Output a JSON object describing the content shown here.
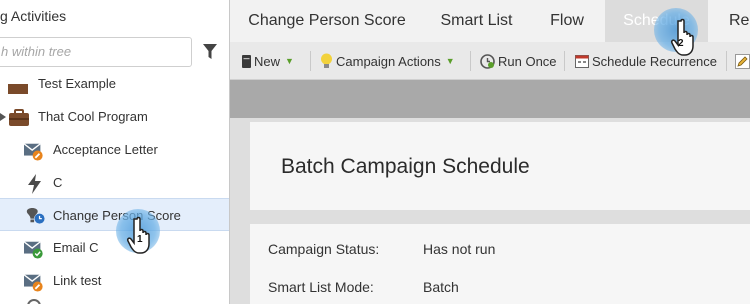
{
  "sidebar": {
    "title": "g Activities",
    "search_placeholder": "h within tree",
    "items": [
      {
        "label": "Test Example",
        "icon": "folder-icon"
      },
      {
        "label": "That Cool Program",
        "icon": "program-briefcase-icon"
      },
      {
        "label": "Acceptance Letter",
        "icon": "email-edit-icon"
      },
      {
        "label": "C",
        "icon": "trigger-bolt-icon"
      },
      {
        "label": "Change Person Score",
        "icon": "batch-campaign-icon"
      },
      {
        "label": "Email C",
        "icon": "email-approved-icon"
      },
      {
        "label": "Link test",
        "icon": "email-edit-icon"
      }
    ]
  },
  "tabs": [
    {
      "label": "Change Person Score"
    },
    {
      "label": "Smart List"
    },
    {
      "label": "Flow"
    },
    {
      "label": "Schedule",
      "active": true
    },
    {
      "label": "Res"
    }
  ],
  "toolbar": {
    "new_label": "New",
    "campaign_actions_label": "Campaign Actions",
    "run_once_label": "Run Once",
    "schedule_recurrence_label": "Schedule Recurrence"
  },
  "content": {
    "title": "Batch Campaign Schedule",
    "rows": [
      {
        "label": "Campaign Status:",
        "value": "Has not run"
      },
      {
        "label": "Smart List Mode:",
        "value": "Batch"
      }
    ]
  },
  "annotations": {
    "step1": "1",
    "step2": "2"
  },
  "colors": {
    "accent_blue": "#3a8fd6",
    "caret_green": "#5a9e2a",
    "selected_bg": "#e4eefb"
  }
}
